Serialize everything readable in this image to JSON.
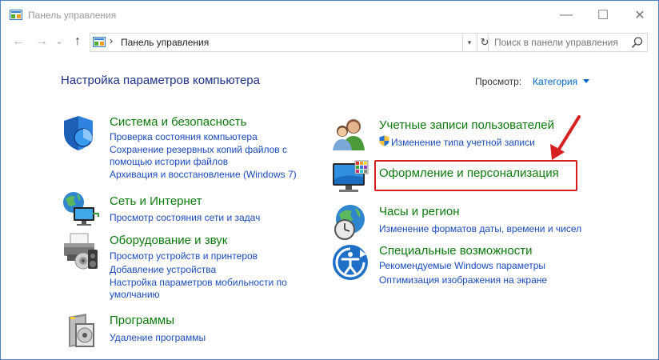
{
  "window": {
    "title": "Панель управления",
    "controls": [
      "—",
      "☐",
      "✕"
    ]
  },
  "nav": {
    "back": "←",
    "forward": "→",
    "recent": "⌄",
    "up": "↑"
  },
  "address": {
    "separator": "›",
    "path": "Панель управления",
    "refresh": "↻"
  },
  "search": {
    "placeholder": "Поиск в панели управления"
  },
  "main": {
    "heading": "Настройка параметров компьютера",
    "view_label": "Просмотр:",
    "view_value": "Категория"
  },
  "categories": {
    "security": {
      "title": "Система и безопасность",
      "links": [
        "Проверка состояния компьютера",
        "Сохранение резервных копий файлов с",
        "помощью истории файлов",
        "Архивация и восстановление (Windows 7)"
      ]
    },
    "network": {
      "title": "Сеть и Интернет",
      "links": [
        "Просмотр состояния сети и задач"
      ]
    },
    "hardware": {
      "title": "Оборудование и звук",
      "links": [
        "Просмотр устройств и принтеров",
        "Добавление устройства",
        "Настройка параметров мобильности по",
        "умолчанию"
      ]
    },
    "programs": {
      "title": "Программы",
      "links": [
        "Удаление программы"
      ]
    },
    "accounts": {
      "title": "Учетные записи пользователей",
      "links": [
        "Изменение типа учетной записи"
      ]
    },
    "appearance": {
      "title": "Оформление и персонализация",
      "links": []
    },
    "clock": {
      "title": "Часы и регион",
      "links": [
        "Изменение форматов даты, времени и чисел"
      ]
    },
    "access": {
      "title": "Специальные возможности",
      "links": [
        "Рекомендуемые Windows параметры",
        "Оптимизация изображения на экране"
      ]
    }
  },
  "colors": {
    "category_title": "#0c7a0c",
    "link": "#1a4bbd",
    "heading": "#1e3287",
    "highlight": "#d62020"
  }
}
